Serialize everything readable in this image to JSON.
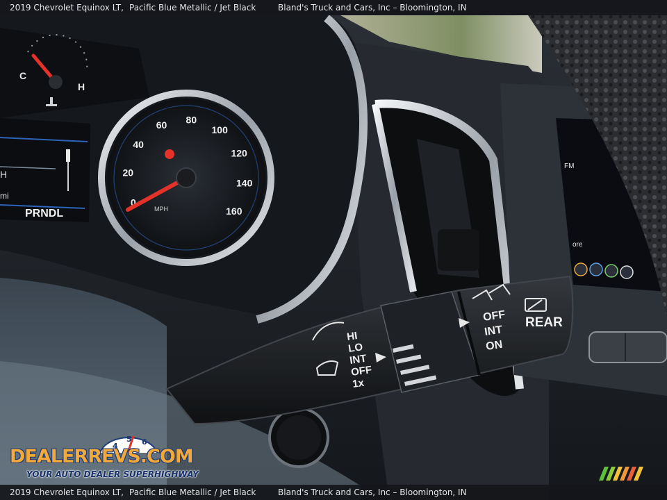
{
  "caption": {
    "vehicle": "2019 Chevrolet Equinox LT,",
    "color": "Pacific Blue Metallic / Jet Black",
    "dealer": "Bland's Truck and Cars, Inc – Bloomington, IN"
  },
  "gauges": {
    "temp_cold": "C",
    "temp_hot": "H",
    "speed_ticks": [
      "0",
      "20",
      "40",
      "60",
      "80",
      "100",
      "120",
      "140",
      "160"
    ],
    "speed_unit": "MPH",
    "gear_indicator": "PRNDL",
    "info_letter_h": "H",
    "info_letter_mi": "mi"
  },
  "wiper_stalk": {
    "front_modes": [
      "HI",
      "LO",
      "INT",
      "OFF",
      "1x"
    ],
    "rear_modes": [
      "OFF",
      "INT",
      "ON"
    ],
    "rear_label": "REAR"
  },
  "infotainment": {
    "fm_label": "FM",
    "more_label": "ore"
  },
  "watermark": {
    "title": "DEALERREVS.COM",
    "tagline": "YOUR AUTO DEALER SUPERHIGHWAY",
    "gauge_digits": [
      "4",
      "5",
      "6"
    ]
  },
  "colors": {
    "needle": "#e2322a",
    "gauge_ring": "#c8ccd2",
    "chrome": "#d9dde2",
    "cluster_blue": "#2d63b8",
    "watermark_orange": "#f2a93b",
    "watermark_navy": "#1d3b78"
  }
}
